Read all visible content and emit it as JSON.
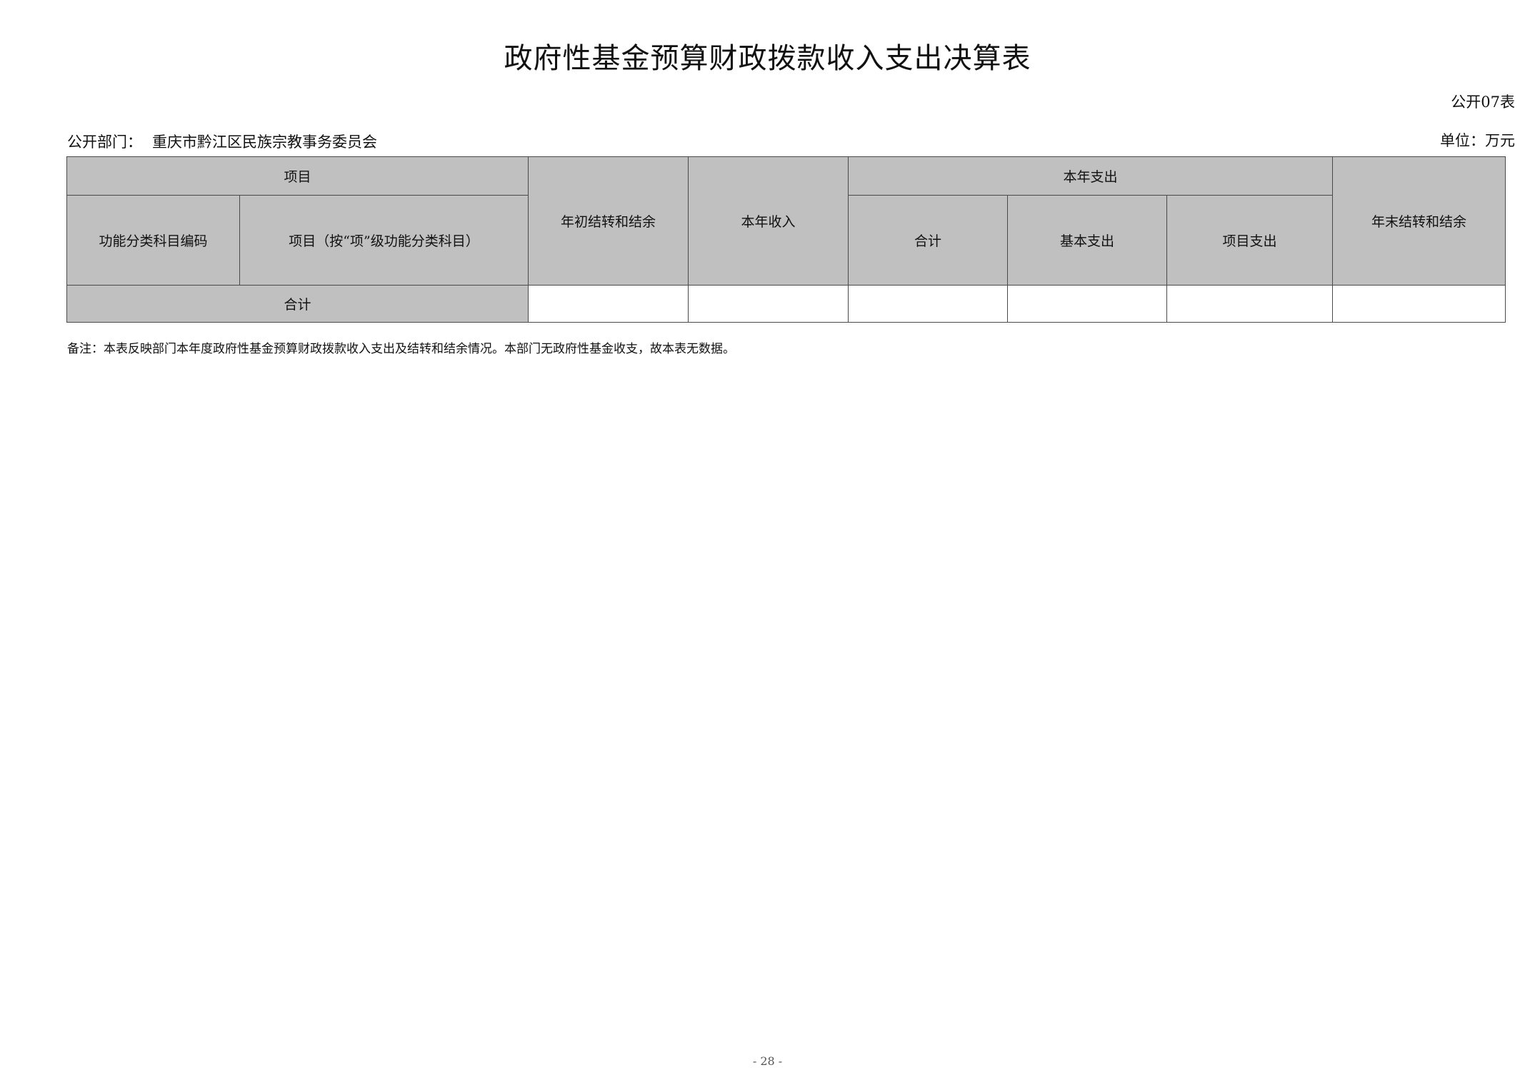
{
  "title": "政府性基金预算财政拨款收入支出决算表",
  "form_code": "公开07表",
  "department": {
    "label": "公开部门：",
    "name": "重庆市黔江区民族宗教事务委员会"
  },
  "unit": "单位：万元",
  "table": {
    "headers": {
      "item_group": "项目",
      "code": "功能分类科目编码",
      "item_name": "项目（按“项”级功能分类科目）",
      "beginning_balance": "年初结转和结余",
      "annual_income": "本年收入",
      "annual_expense_group": "本年支出",
      "total": "合计",
      "basic_expense": "基本支出",
      "project_expense": "项目支出",
      "ending_balance": "年末结转和结余"
    },
    "total_row": {
      "label": "合计",
      "beginning_balance": "",
      "annual_income": "",
      "expense_total": "",
      "basic_expense": "",
      "project_expense": "",
      "ending_balance": ""
    }
  },
  "note": "备注：本表反映部门本年度政府性基金预算财政拨款收入支出及结转和结余情况。本部门无政府性基金收支，故本表无数据。",
  "page_number": "- 28 -"
}
